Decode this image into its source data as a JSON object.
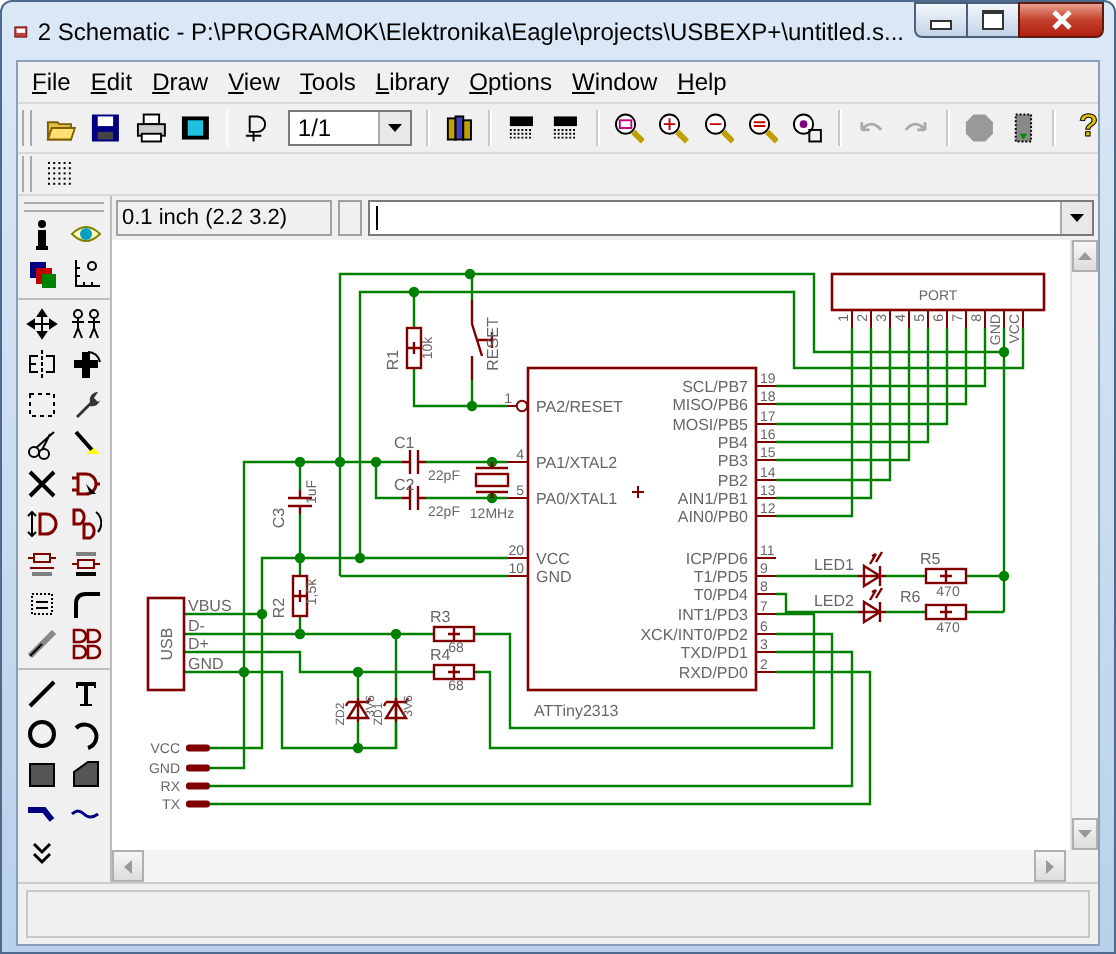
{
  "window": {
    "title": "2 Schematic - P:\\PROGRAMOK\\Elektronika\\Eagle\\projects\\USBEXP+\\untitled.s..."
  },
  "menu": [
    "File",
    "Edit",
    "Draw",
    "View",
    "Tools",
    "Library",
    "Options",
    "Window",
    "Help"
  ],
  "toolbar": {
    "sheet": "1/1",
    "help": "?"
  },
  "command_bar": {
    "grid": "0.1 inch (2.2 3.2)"
  },
  "schematic": {
    "chip": {
      "name": "ATTiny2313",
      "left_pins": [
        {
          "number": "1",
          "name": "PA2/RESET"
        },
        {
          "number": "4",
          "name": "PA1/XTAL2"
        },
        {
          "number": "5",
          "name": "PA0/XTAL1"
        },
        {
          "number": "20",
          "name": "VCC"
        },
        {
          "number": "10",
          "name": "GND"
        }
      ],
      "right_pins": [
        {
          "number": "19",
          "name": "SCL/PB7"
        },
        {
          "number": "18",
          "name": "MISO/PB6"
        },
        {
          "number": "17",
          "name": "MOSI/PB5"
        },
        {
          "number": "16",
          "name": "PB4"
        },
        {
          "number": "15",
          "name": "PB3"
        },
        {
          "number": "14",
          "name": "PB2"
        },
        {
          "number": "13",
          "name": "AIN1/PB1"
        },
        {
          "number": "12",
          "name": "AIN0/PB0"
        },
        {
          "number": "11",
          "name": "ICP/PD6"
        },
        {
          "number": "9",
          "name": "T1/PD5"
        },
        {
          "number": "8",
          "name": "T0/PD4"
        },
        {
          "number": "7",
          "name": "INT1/PD3"
        },
        {
          "number": "6",
          "name": "XCK/INT0/PD2"
        },
        {
          "number": "3",
          "name": "TXD/PD1"
        },
        {
          "number": "2",
          "name": "RXD/PD0"
        }
      ]
    },
    "port": {
      "label": "PORT",
      "pins": [
        "1",
        "2",
        "3",
        "4",
        "5",
        "6",
        "7",
        "8",
        "GND",
        "VCC"
      ]
    },
    "usb": {
      "label": "USB",
      "pins": [
        "VBUS",
        "D-",
        "D+",
        "GND"
      ]
    },
    "terminals": [
      "VCC",
      "GND",
      "RX",
      "TX"
    ],
    "parts": [
      {
        "kind": "resistor",
        "name": "R1",
        "value": "10k"
      },
      {
        "kind": "switch",
        "name": "RESET"
      },
      {
        "kind": "capacitor",
        "name": "C1",
        "value": "22pF"
      },
      {
        "kind": "capacitor",
        "name": "C2",
        "value": "22pF"
      },
      {
        "kind": "crystal",
        "value": "12MHz"
      },
      {
        "kind": "capacitor",
        "name": "C3",
        "value": "1uF"
      },
      {
        "kind": "resistor",
        "name": "R2",
        "value": "1,5k"
      },
      {
        "kind": "resistor",
        "name": "R3",
        "value": "68"
      },
      {
        "kind": "resistor",
        "name": "R4",
        "value": "68"
      },
      {
        "kind": "zener",
        "name": "ZD2",
        "value": "3V6"
      },
      {
        "kind": "zener",
        "name": "ZD1",
        "value": "3V6"
      },
      {
        "kind": "led",
        "name": "LED1"
      },
      {
        "kind": "led",
        "name": "LED2"
      },
      {
        "kind": "resistor",
        "name": "R5",
        "value": "470"
      },
      {
        "kind": "resistor",
        "name": "R6",
        "value": "470"
      }
    ]
  }
}
